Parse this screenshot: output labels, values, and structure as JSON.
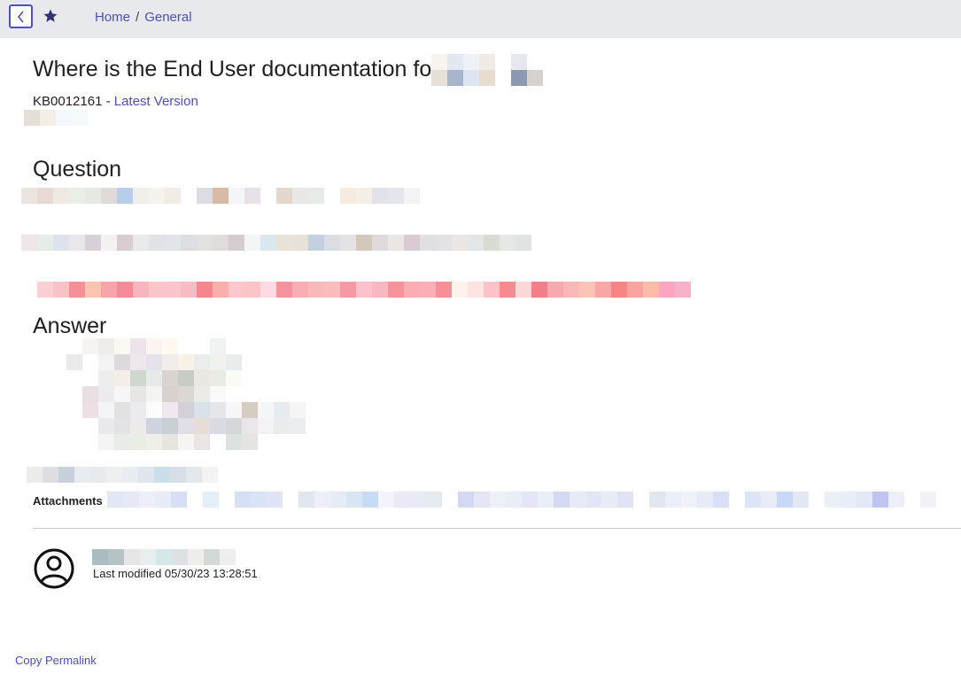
{
  "breadcrumb": {
    "home": "Home",
    "separator": "/",
    "current": "General"
  },
  "article": {
    "title": "Where is the End User documentation for",
    "number": "KB0012161",
    "number_separator": "-",
    "version_link": "Latest Version"
  },
  "sections": {
    "question": "Question",
    "answer": "Answer",
    "attachments": "Attachments"
  },
  "footer": {
    "last_modified": "Last modified 05/30/23 13:28:51",
    "permalink": "Copy Permalink"
  },
  "icons": {
    "back": "chevron-left-icon",
    "favorite": "star-icon",
    "author": "user-circle-icon"
  },
  "colors": {
    "accent": "#4a4fb8",
    "topbar": "#e7e9ed"
  }
}
